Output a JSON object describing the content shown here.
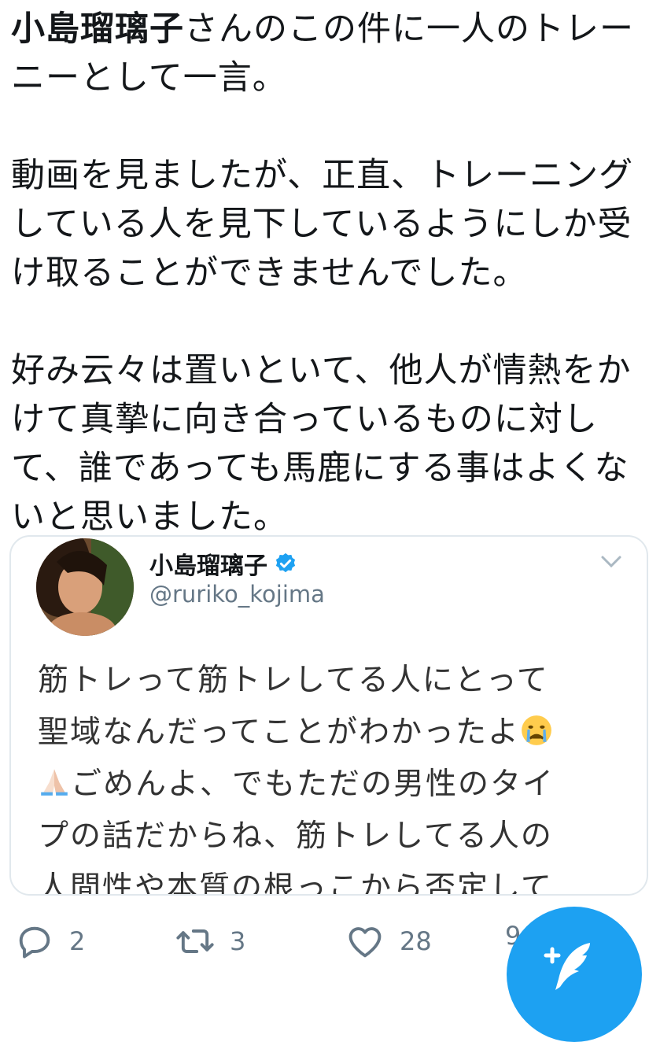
{
  "tweet": {
    "mention": "小島瑠璃子",
    "lines": {
      "l1_rest": "さんのこの件に一人のトレー",
      "l2": "ニーとして一言。",
      "p2": [
        "動画を見ましたが、正直、トレーニング",
        "している人を見下しているようにしか受",
        "け取ることができませんでした。"
      ],
      "p3": [
        "好み云々は置いといて、他人が情熱をか",
        "けて真摯に向き合っているものに対し",
        "て、誰であっても馬鹿にする事はよくな",
        "いと思いました。"
      ]
    }
  },
  "quoted_tweet": {
    "name": "小島瑠璃子",
    "handle": "@ruriko_kojima",
    "lines": [
      "筋トレって筋トレしてる人にとって",
      "聖域なんだってことがわかったよ",
      "ごめんよ、でもただの男性のタイ",
      "プの話だからね、筋トレしてる人の",
      "人間性や本質の根っこから否定して"
    ],
    "emoji": [
      "crying-face",
      "praying-hands"
    ]
  },
  "actions": {
    "reply_count": "2",
    "retweet_count": "3",
    "like_count": "28",
    "share_count": "9"
  },
  "colors": {
    "accent": "#1da1f2",
    "text": "#14171a",
    "muted": "#657786",
    "border": "#e1e8ed"
  }
}
